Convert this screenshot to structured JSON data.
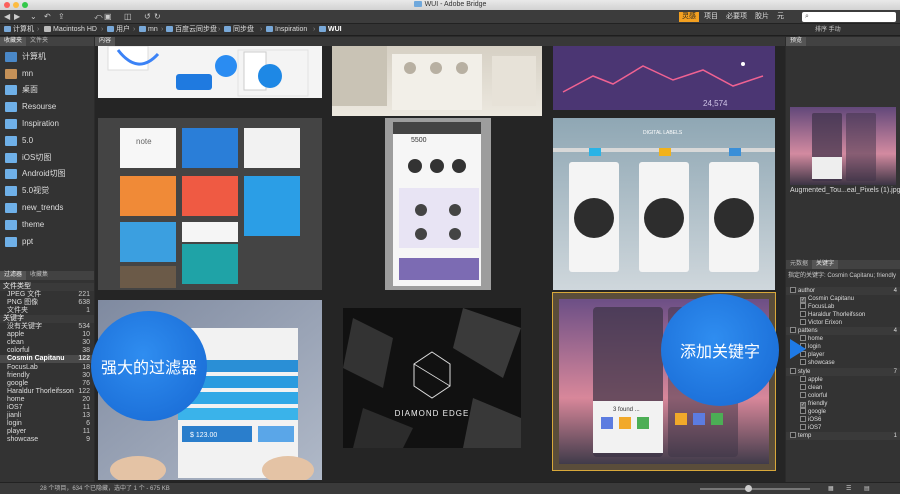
{
  "window": {
    "title": "WUI - Adobe Bridge"
  },
  "toolbar": {
    "workspaces": [
      "灵感",
      "项目",
      "必要项",
      "胶片",
      "元"
    ],
    "search_placeholder": "",
    "search_icon_glyph": "⌕"
  },
  "path": {
    "crumbs": [
      "计算机",
      "Macintosh HD",
      "用户",
      "mn",
      "百度云同步盘",
      "同步盘",
      "Inspiration",
      "WUI"
    ],
    "sort_label": "排序 手动"
  },
  "left": {
    "tabs": [
      "收藏夹",
      "文件夹"
    ],
    "favorites": [
      "计算机",
      "mn",
      "桌面",
      "Resourse",
      "Inspiration",
      "5.0",
      "iOS切图",
      "Android切图",
      "5.0视觉",
      "new_trends",
      "theme",
      "ppt"
    ],
    "filter_tabs": [
      "过滤器",
      "收藏集"
    ],
    "filters": [
      {
        "label": "文件类型",
        "count": "",
        "kind": "cat"
      },
      {
        "label": "JPEG 文件",
        "count": "221"
      },
      {
        "label": "PNG 图像",
        "count": "638"
      },
      {
        "label": "文件夹",
        "count": "1"
      },
      {
        "label": "关键字",
        "count": "",
        "kind": "cat"
      },
      {
        "label": "没有关键字",
        "count": "534"
      },
      {
        "label": "apple",
        "count": "10"
      },
      {
        "label": "clean",
        "count": "30"
      },
      {
        "label": "colorful",
        "count": "38"
      },
      {
        "label": "Cosmin Capitanu",
        "count": "122",
        "kind": "sel"
      },
      {
        "label": "FocusLab",
        "count": "18"
      },
      {
        "label": "friendly",
        "count": "30"
      },
      {
        "label": "google",
        "count": "76"
      },
      {
        "label": "Haraldur Thorleifsson",
        "count": "122"
      },
      {
        "label": "home",
        "count": "20"
      },
      {
        "label": "iOS7",
        "count": "11"
      },
      {
        "label": "jianli",
        "count": "13"
      },
      {
        "label": "login",
        "count": "6"
      },
      {
        "label": "player",
        "count": "11"
      },
      {
        "label": "showcase",
        "count": "9"
      }
    ]
  },
  "center": {
    "tab": "内容",
    "thumbs": [
      {
        "caption": ""
      },
      {
        "caption": ""
      },
      {
        "caption": ""
      },
      {
        "caption": ""
      },
      {
        "caption": "5500"
      },
      {
        "caption": "DIGITAL LABELS"
      },
      {
        "caption": ""
      },
      {
        "caption": "DIAMOND EDGE"
      },
      {
        "caption": "3 found ..."
      }
    ],
    "price": "$ 123.00"
  },
  "right": {
    "tab": "预览",
    "preview_caption": "Augmented_Tou...eal_Pixels (1).jpg",
    "meta_tabs": [
      "元数据",
      "关键字"
    ],
    "assigned": "指定的关键字: Cosmin Capitanu; friendly",
    "keywords": [
      {
        "label": "author",
        "count": "4",
        "kind": "cat",
        "checked": false
      },
      {
        "label": "Cosmin Capitanu",
        "count": "",
        "checked": true
      },
      {
        "label": "FocusLab",
        "count": "",
        "checked": false
      },
      {
        "label": "Haraldur Thorleifsson",
        "count": "",
        "checked": false
      },
      {
        "label": "Victor Erixon",
        "count": "",
        "checked": false
      },
      {
        "label": "pattens",
        "count": "4",
        "kind": "cat",
        "checked": false
      },
      {
        "label": "home",
        "count": "",
        "checked": false
      },
      {
        "label": "login",
        "count": "",
        "checked": false
      },
      {
        "label": "player",
        "count": "",
        "checked": false
      },
      {
        "label": "showcase",
        "count": "",
        "checked": false
      },
      {
        "label": "style",
        "count": "7",
        "kind": "cat",
        "checked": false
      },
      {
        "label": "apple",
        "count": "",
        "checked": false
      },
      {
        "label": "clean",
        "count": "",
        "checked": false
      },
      {
        "label": "colorful",
        "count": "",
        "checked": false
      },
      {
        "label": "friendly",
        "count": "",
        "checked": true
      },
      {
        "label": "google",
        "count": "",
        "checked": false
      },
      {
        "label": "iOS6",
        "count": "",
        "checked": false
      },
      {
        "label": "iOS7",
        "count": "",
        "checked": false
      },
      {
        "label": "temp",
        "count": "1",
        "kind": "cat",
        "checked": false
      }
    ]
  },
  "callouts": {
    "left": "强大的过滤器",
    "right": "添加关键字"
  },
  "status": {
    "text": "28 个项目，634 个已隐藏，选中了 1 个 - 675 KB"
  },
  "colors": {
    "accent": "#f3a020",
    "bubble": "#1e7ae6",
    "selection": "#d8a83a"
  }
}
